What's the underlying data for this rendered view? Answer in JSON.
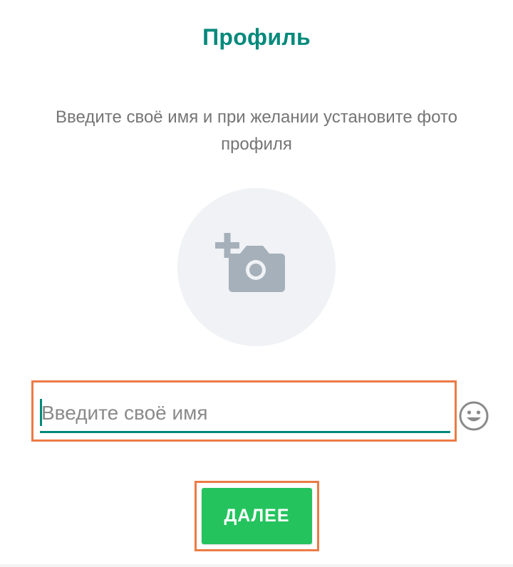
{
  "screen": {
    "title": "Профиль",
    "subtitle": "Введите своё имя и при желании установите фото профиля"
  },
  "avatar": {
    "icon": "add-photo-camera-icon"
  },
  "name_field": {
    "placeholder": "Введите своё имя",
    "value": ""
  },
  "emoji_button": {
    "icon": "smiley-face-icon"
  },
  "next_button": {
    "label": "ДАЛЕЕ"
  },
  "colors": {
    "accent": "#00897b",
    "button": "#25c35e",
    "highlight": "#ec7b45",
    "icon_gray": "#a5b0ba",
    "avatar_bg": "#f0f2f5"
  }
}
